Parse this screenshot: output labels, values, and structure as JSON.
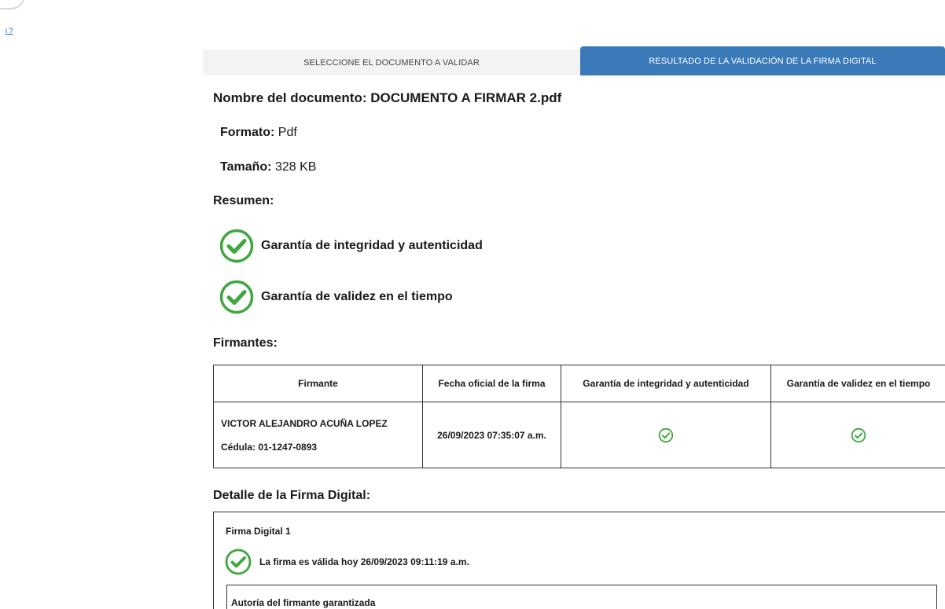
{
  "corner": {
    "link_text": "i ?"
  },
  "tabs": [
    {
      "label": "SELECCIONE EL DOCUMENTO A VALIDAR"
    },
    {
      "label": "RESULTADO DE LA VALIDACIÓN DE LA FIRMA DIGITAL"
    }
  ],
  "document": {
    "name_label": "Nombre del documento: DOCUMENTO A FIRMAR 2.pdf",
    "format_label": "Formato:",
    "format_value": "Pdf",
    "size_label": "Tamaño:",
    "size_value": "328 KB"
  },
  "summary": {
    "title": "Resumen:",
    "items": [
      {
        "label": "Garantía de integridad y autenticidad",
        "icon": "check-circle-icon"
      },
      {
        "label": "Garantía de validez en el tiempo",
        "icon": "check-circle-icon"
      }
    ]
  },
  "signers": {
    "title": "Firmantes:",
    "columns": [
      "Firmante",
      "Fecha oficial de la firma",
      "Garantía de integridad y autenticidad",
      "Garantía de validez en el tiempo"
    ],
    "rows": [
      {
        "name": "VICTOR ALEJANDRO ACUÑA LOPEZ",
        "id": "Cédula: 01-1247-0893",
        "date": "26/09/2023 07:35:07 a.m.",
        "integrity": "check-circle-icon",
        "validity": "check-circle-icon"
      }
    ]
  },
  "detail": {
    "title": "Detalle de la Firma Digital:",
    "signature_title": "Firma Digital 1",
    "valid_text": "La firma es válida hoy 26/09/2023 09:11:19 a.m.",
    "inner_title": "Autoría del firmante garantizada"
  },
  "colors": {
    "tab_active_bg": "#3a7ab9",
    "tab_inactive_bg": "#f3f3f3",
    "check_green": "#3fa73f"
  }
}
